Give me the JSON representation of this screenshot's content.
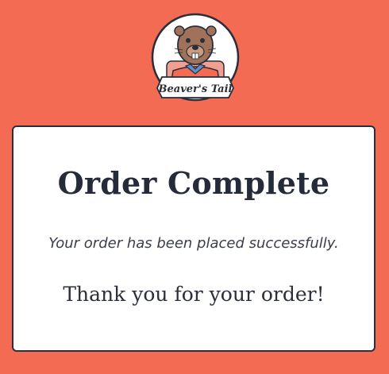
{
  "logo": {
    "text": "Beaver's Tail",
    "icon": "beaver-mascot-icon"
  },
  "order": {
    "title": "Order Complete",
    "subtitle": "Your order has been placed successfully.",
    "thanks": "Thank you for your order!"
  },
  "colors": {
    "background": "#f26b52",
    "card": "#ffffff",
    "text": "#262b3a"
  }
}
